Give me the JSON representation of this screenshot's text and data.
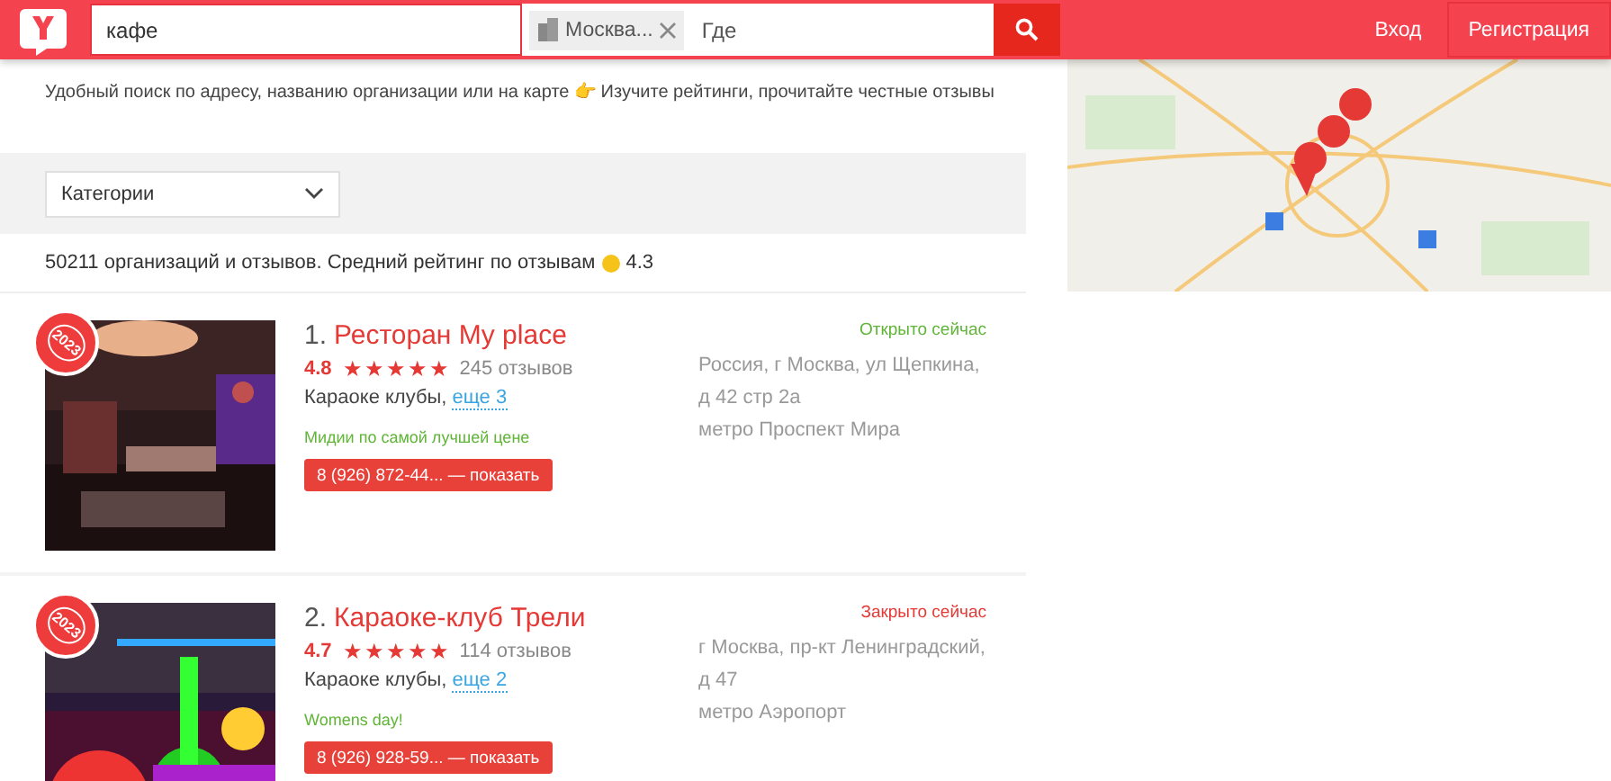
{
  "header": {
    "search": {
      "value": "кафе"
    },
    "location_chip": "Москва...",
    "where": {
      "placeholder": "Где"
    },
    "login": "Вход",
    "register": "Регистрация"
  },
  "intro": "Удобный поиск по адресу, названию организации или на карте 👉 Изучите рейтинги, прочитайте честные отзывы",
  "categories": {
    "label": "Категории"
  },
  "summary": "50211 организаций и отзывов. Средний рейтинг по отзывам",
  "summary_rating": "4.3",
  "results": [
    {
      "number": "1.",
      "name": "Ресторан My place",
      "status": "Открыто сейчас",
      "open": true,
      "rating": "4.8",
      "stars": 5,
      "reviews": "245 отзывов",
      "category": "Караоке клубы,",
      "more": "еще 3",
      "promo": "Мидии по самой лучшей цене",
      "phone": "8 (926) 872-44... — показать",
      "address": "Россия, г Москва, ул Щепкина, д 42 стр 2а",
      "metro": "метро Проспект Мира",
      "badge": "2023"
    },
    {
      "number": "2.",
      "name": "Караоке-клуб Трели",
      "status": "Закрыто сейчас",
      "open": false,
      "rating": "4.7",
      "stars": 5,
      "reviews": "114 отзывов",
      "category": "Караоке клубы,",
      "more": "еще 2",
      "promo": "Womens day!",
      "phone": "8 (926) 928-59... — показать",
      "address": "г Москва, пр-кт Ленинградский, д 47",
      "metro": "метро Аэропорт",
      "badge": "2023"
    }
  ]
}
